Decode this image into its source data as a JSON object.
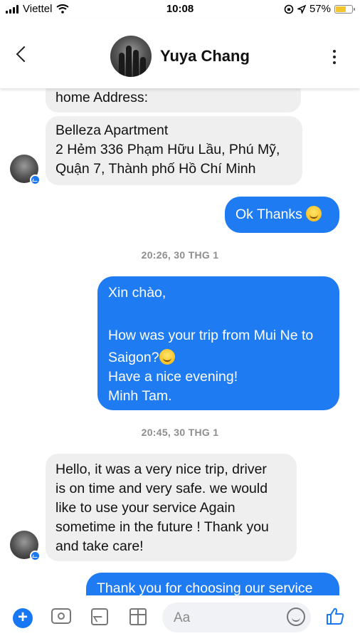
{
  "status_bar": {
    "carrier": "Viettel",
    "time": "10:08",
    "battery": "57%",
    "battery_level": 0.57
  },
  "header": {
    "contact_name": "Yuya Chang"
  },
  "messages": [
    {
      "id": "m1",
      "from": "contact",
      "lines": [
        "home Address:"
      ]
    },
    {
      "id": "m2",
      "from": "contact",
      "lines": [
        "Belleza Apartment",
        "2 Hẻm 336 Phạm Hữu Lầu, Phú Mỹ,",
        "Quận 7, Thành phố Hồ Chí Minh"
      ]
    },
    {
      "id": "m3",
      "from": "me",
      "lines": [
        "Ok Thanks"
      ]
    },
    {
      "id": "m4",
      "from": "me",
      "lines": [
        "Xin chào,",
        "",
        "How was your trip from Mui Ne to",
        "Saigon?",
        "Have a nice evening!",
        "Minh Tam."
      ]
    },
    {
      "id": "m5",
      "from": "contact",
      "lines": [
        "Hello, it was a very nice trip, driver",
        "is on time and very safe. we would",
        "like to use your service Again",
        "sometime in the future ! Thank you",
        "and take care!"
      ]
    },
    {
      "id": "m6",
      "from": "me",
      "lines": [
        "Thank you for choosing our service"
      ]
    }
  ],
  "timestamps": [
    "20:26, 30 THG 1",
    "20:45, 30 THG 1"
  ],
  "composer": {
    "placeholder": "Aa"
  },
  "icons": [
    "wifi-icon",
    "location-icon",
    "back-icon",
    "more-icon",
    "plus-icon",
    "camera-icon",
    "image-icon",
    "sticker-icon",
    "emoji-icon",
    "like-icon"
  ]
}
